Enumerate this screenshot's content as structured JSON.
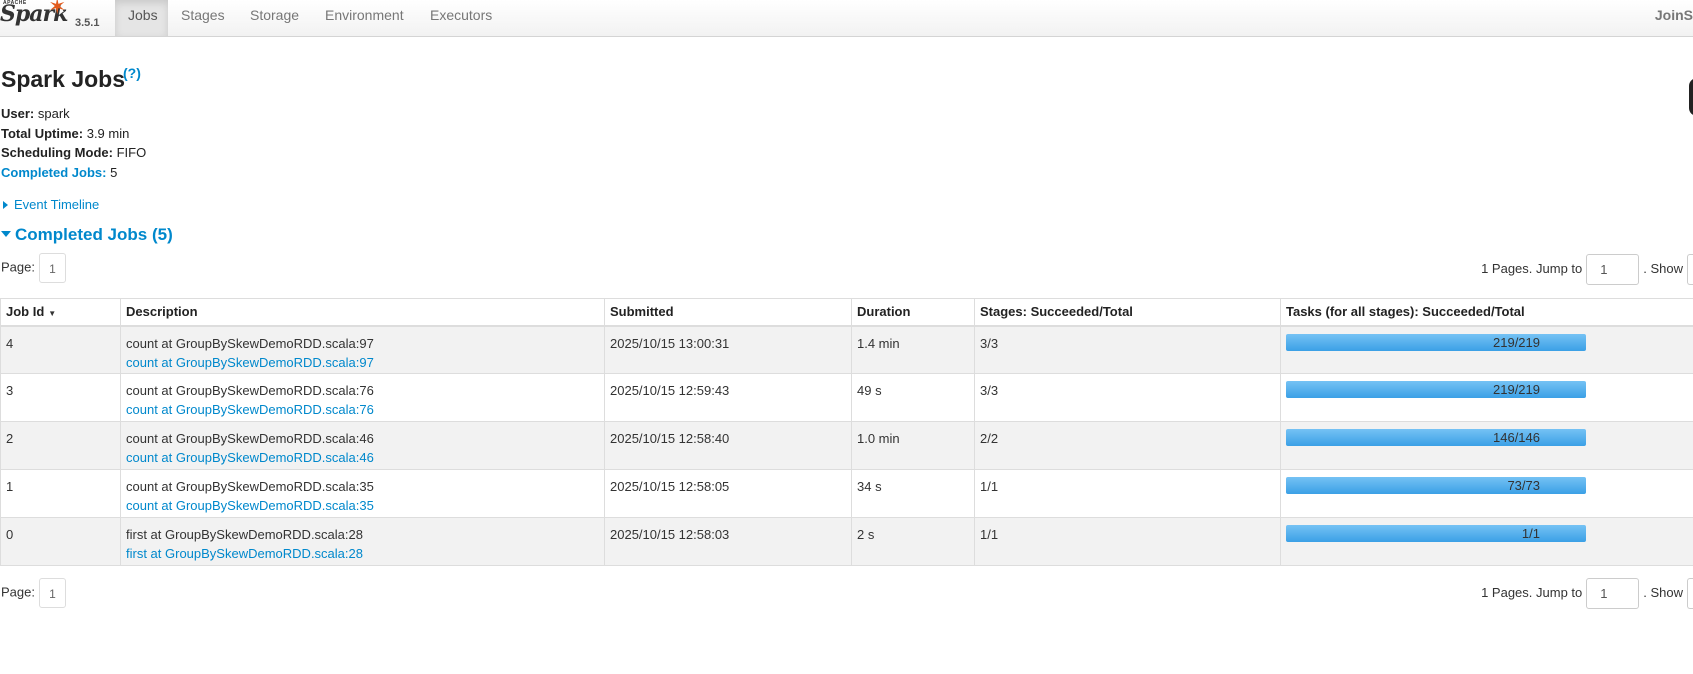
{
  "nav": {
    "brand_apache": "APACHE",
    "brand_name": "Spark",
    "version": "3.5.1",
    "tabs": [
      {
        "label": "Jobs",
        "active": true
      },
      {
        "label": "Stages",
        "active": false
      },
      {
        "label": "Storage",
        "active": false
      },
      {
        "label": "Environment",
        "active": false
      },
      {
        "label": "Executors",
        "active": false
      }
    ],
    "app_name": "JoinS"
  },
  "header": {
    "title": "Spark Jobs",
    "help": "(?)"
  },
  "summary": {
    "user_label": "User:",
    "user": "spark",
    "uptime_label": "Total Uptime:",
    "uptime": "3.9 min",
    "scheduling_label": "Scheduling Mode:",
    "scheduling": "FIFO",
    "completed_label": "Completed Jobs:",
    "completed": "5"
  },
  "event_timeline": "Event Timeline",
  "completed_section": "Completed Jobs (5)",
  "pagination": {
    "page_label": "Page:",
    "page": "1",
    "pages_text": "1 Pages. Jump to",
    "jump_value": "1",
    "show_text": ". Show"
  },
  "table": {
    "columns": [
      "Job Id",
      "Description",
      "Submitted",
      "Duration",
      "Stages: Succeeded/Total",
      "Tasks (for all stages): Succeeded/Total"
    ],
    "sort_indicator": "▼",
    "rows": [
      {
        "id": "4",
        "desc": "count at GroupBySkewDemoRDD.scala:97",
        "desc_link": "count at GroupBySkewDemoRDD.scala:97",
        "submitted": "2025/10/15 13:00:31",
        "duration": "1.4 min",
        "stages": "3/3",
        "tasks": "219/219",
        "progress": 1.0
      },
      {
        "id": "3",
        "desc": "count at GroupBySkewDemoRDD.scala:76",
        "desc_link": "count at GroupBySkewDemoRDD.scala:76",
        "submitted": "2025/10/15 12:59:43",
        "duration": "49 s",
        "stages": "3/3",
        "tasks": "219/219",
        "progress": 1.0
      },
      {
        "id": "2",
        "desc": "count at GroupBySkewDemoRDD.scala:46",
        "desc_link": "count at GroupBySkewDemoRDD.scala:46",
        "submitted": "2025/10/15 12:58:40",
        "duration": "1.0 min",
        "stages": "2/2",
        "tasks": "146/146",
        "progress": 1.0
      },
      {
        "id": "1",
        "desc": "count at GroupBySkewDemoRDD.scala:35",
        "desc_link": "count at GroupBySkewDemoRDD.scala:35",
        "submitted": "2025/10/15 12:58:05",
        "duration": "34 s",
        "stages": "1/1",
        "tasks": "73/73",
        "progress": 1.0
      },
      {
        "id": "0",
        "desc": "first at GroupBySkewDemoRDD.scala:28",
        "desc_link": "first at GroupBySkewDemoRDD.scala:28",
        "submitted": "2025/10/15 12:58:03",
        "duration": "2 s",
        "stages": "1/1",
        "tasks": "1/1",
        "progress": 1.0
      }
    ]
  },
  "colors": {
    "accent": "#0088cc",
    "brand_orange": "#e25a1c",
    "progress_fill": "#3ba0e6"
  }
}
